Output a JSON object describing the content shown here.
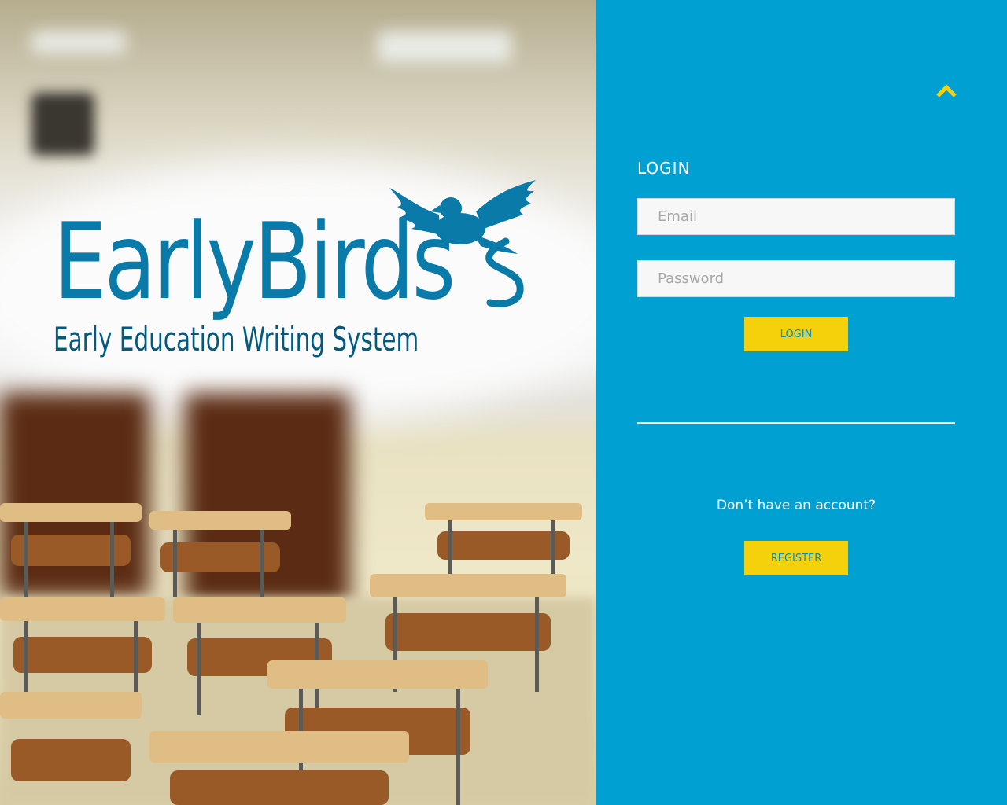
{
  "brand": {
    "logo_title": "EarlyBirds",
    "logo_subtitle": "Early Education Writing System",
    "primary_color": "#00a0d2",
    "logo_color": "#0a7aa9",
    "accent_color": "#f5d10b"
  },
  "panel": {
    "collapse_icon": "chevron-up-icon",
    "title": "LOGIN",
    "email": {
      "placeholder": "Email",
      "value": ""
    },
    "password": {
      "placeholder": "Password",
      "value": ""
    },
    "login_label": "LOGIN",
    "no_account_text": "Don’t have an account?",
    "register_label": "REGISTER"
  },
  "icons": {
    "bird": "bird-icon",
    "collapse": "chevron-up-icon"
  }
}
